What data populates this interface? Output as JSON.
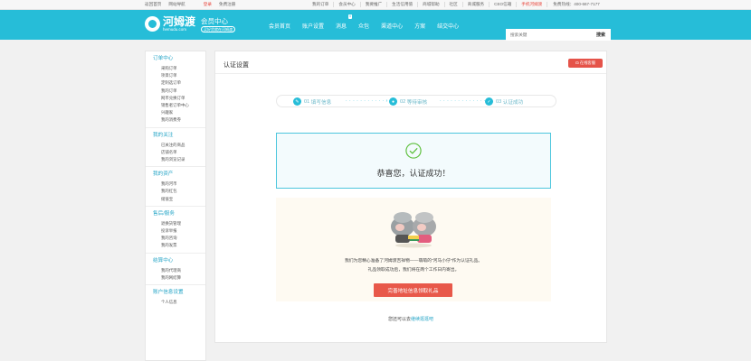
{
  "topbar": {
    "home": "返回首页",
    "favorite": "网站导航",
    "login": "登录",
    "register": "免费注册",
    "links": [
      "我的订单",
      "会员中心",
      "我要推广",
      "生活信用值",
      "商城帮助",
      "社区",
      "商城服务",
      "CEO信箱"
    ],
    "app": "手机河姆渡",
    "hotline": "免费热线：400-667-7177"
  },
  "header": {
    "logo": "河姆渡",
    "logo_sub": "hemudu.com",
    "member_center": "会员中心",
    "member_sub": "买好货就在河姆渡",
    "nav": [
      "会员首页",
      "账户设置",
      "消息",
      "众包",
      "渠道中心",
      "方案",
      "结交中心"
    ],
    "message_badge": "0",
    "search_placeholder": "搜索关键",
    "search_button": "搜索"
  },
  "sidebar": [
    {
      "title": "订单中心",
      "items": [
        "采购订单",
        "项目订单",
        "定制选订单",
        "我的订单",
        "网币兑换订单",
        "销售者订单中心",
        "兴趣家",
        "我的消费券"
      ]
    },
    {
      "title": "我的关注",
      "items": [
        "已关注的商品",
        "店铺名单",
        "我的浏览记录"
      ]
    },
    {
      "title": "我的资产",
      "items": [
        "我的河币",
        "我的红包",
        "储值宝"
      ]
    },
    {
      "title": "售后/服务",
      "items": [
        "退换货管理",
        "投诉举报",
        "我的咨询",
        "我的发票"
      ]
    },
    {
      "title": "结算中心",
      "items": [
        "我的代理商",
        "我的网结算"
      ]
    },
    {
      "title": "账户信息设置",
      "items": [
        "个人信息"
      ]
    }
  ],
  "main": {
    "title": "认证设置",
    "help_button": "在线客服",
    "steps": [
      {
        "num": "01",
        "label": "填写信息"
      },
      {
        "num": "02",
        "label": "等待审核"
      },
      {
        "num": "03",
        "label": "认证成功"
      }
    ],
    "success_message": "恭喜您，认证成功！",
    "gift_line1": "我们为您精心准备了河姆渡吉祥物——萌萌的\"河马小仔\"作为认证礼品。",
    "gift_line2": "礼品领取成功后，我们将在两个工作日内寄出。",
    "gift_button": "完善地址信息领取礼品",
    "continue_prefix": "您还可以去",
    "continue_link": "继续逛逛吧"
  },
  "colors": {
    "brand": "#26bdd8",
    "accent_red": "#e55349",
    "success_border": "#4dc6dd"
  }
}
